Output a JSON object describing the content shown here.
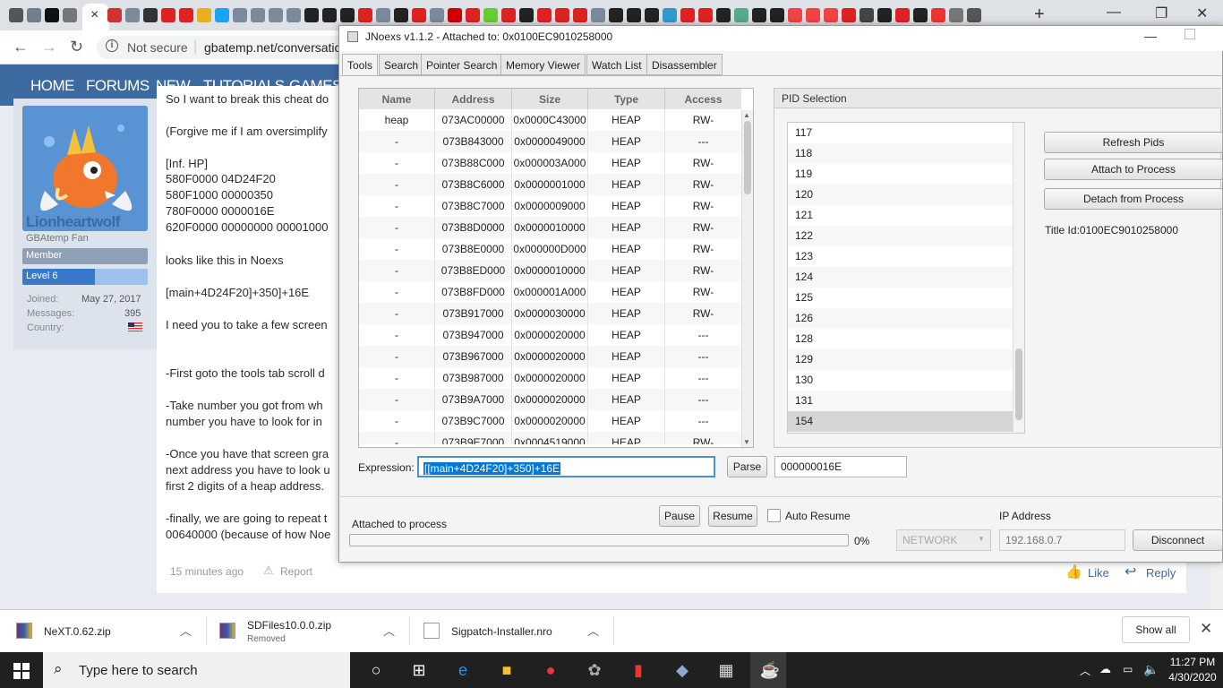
{
  "browser": {
    "tab_close_glyph": "×",
    "new_tab_glyph": "+",
    "url_security": "Not secure",
    "url_text": "gbatemp.net/conversatic",
    "window_buttons": [
      "—",
      "❐",
      "✕"
    ]
  },
  "site": {
    "nav": [
      "HOME",
      "FORUMS",
      "NEW",
      "TUTORIALS",
      "GAMES"
    ],
    "user": {
      "name": "Lionheartwolf",
      "title": "GBAtemp Fan",
      "role": "Member",
      "level": "Level 6",
      "joined_label": "Joined:",
      "joined": "May 27, 2017",
      "messages_label": "Messages:",
      "messages": "395",
      "country_label": "Country:"
    },
    "post_lines": [
      "So I want to break this cheat do",
      "(Forgive me if I am oversimplify",
      "[Inf. HP]",
      "580F0000 04D24F20",
      "580F1000 00000350",
      "780F0000 0000016E",
      "620F0000 00000000 00001000",
      "looks like this in Noexs",
      "[main+4D24F20]+350]+16E",
      "I need you to take a few screen",
      "-First goto the tools tab scroll d",
      "-Take number you got from wh",
      "number you have to look for in",
      "-Once you have that screen gra",
      "next address you have to look u",
      "first 2 digits of a heap address.",
      "-finally, we are going to repeat t",
      "00640000 (because of how Noe"
    ],
    "post_time": "15 minutes ago",
    "report": "Report",
    "like": "Like",
    "reply": "Reply"
  },
  "jnoexs": {
    "title": "JNoexs v1.1.2 - Attached to: 0x0100EC9010258000",
    "tabs": [
      "Tools",
      "Search",
      "Pointer Search",
      "Memory Viewer",
      "Watch List",
      "Disassembler"
    ],
    "columns": [
      "Name",
      "Address",
      "Size",
      "Type",
      "Access"
    ],
    "rows": [
      [
        "heap",
        "073AC00000",
        "0x0000C43000",
        "HEAP",
        "RW-"
      ],
      [
        "-",
        "073B843000",
        "0x0000049000",
        "HEAP",
        "---"
      ],
      [
        "-",
        "073B88C000",
        "0x000003A000",
        "HEAP",
        "RW-"
      ],
      [
        "-",
        "073B8C6000",
        "0x0000001000",
        "HEAP",
        "RW-"
      ],
      [
        "-",
        "073B8C7000",
        "0x0000009000",
        "HEAP",
        "RW-"
      ],
      [
        "-",
        "073B8D0000",
        "0x0000010000",
        "HEAP",
        "RW-"
      ],
      [
        "-",
        "073B8E0000",
        "0x000000D000",
        "HEAP",
        "RW-"
      ],
      [
        "-",
        "073B8ED000",
        "0x0000010000",
        "HEAP",
        "RW-"
      ],
      [
        "-",
        "073B8FD000",
        "0x000001A000",
        "HEAP",
        "RW-"
      ],
      [
        "-",
        "073B917000",
        "0x0000030000",
        "HEAP",
        "RW-"
      ],
      [
        "-",
        "073B947000",
        "0x0000020000",
        "HEAP",
        "---"
      ],
      [
        "-",
        "073B967000",
        "0x0000020000",
        "HEAP",
        "---"
      ],
      [
        "-",
        "073B987000",
        "0x0000020000",
        "HEAP",
        "---"
      ],
      [
        "-",
        "073B9A7000",
        "0x0000020000",
        "HEAP",
        "---"
      ],
      [
        "-",
        "073B9C7000",
        "0x0000020000",
        "HEAP",
        "---"
      ],
      [
        "-",
        "073B9E7000",
        "0x0004519000",
        "HEAP",
        "RW-"
      ]
    ],
    "pid_title": "PID Selection",
    "pids": [
      "117",
      "118",
      "119",
      "120",
      "121",
      "122",
      "123",
      "124",
      "125",
      "126",
      "128",
      "129",
      "130",
      "131",
      "154"
    ],
    "selected_pid": "154",
    "refresh_pids": "Refresh Pids",
    "attach": "Attach to Process",
    "detach": "Detach from Process",
    "title_id": "Title Id:0100EC9010258000",
    "expression_label": "Expression:",
    "expression_value": "[[main+4D24F20]+350]+16E",
    "parse": "Parse",
    "parse_result": "000000016E",
    "pause": "Pause",
    "resume": "Resume",
    "auto_resume": "Auto Resume",
    "status": "Attached to process",
    "progress_percent": 0,
    "progress_text": "0%",
    "network": "NETWORK",
    "ip_label": "IP Address",
    "ip_placeholder": "192.168.0.7",
    "disconnect": "Disconnect"
  },
  "downloads": {
    "items": [
      {
        "name": "NeXT.0.62.zip",
        "sub": ""
      },
      {
        "name": "SDFiles10.0.0.zip",
        "sub": "Removed"
      },
      {
        "name": "Sigpatch-Installer.nro",
        "sub": ""
      }
    ],
    "show_all": "Show all"
  },
  "taskbar": {
    "search_placeholder": "Type here to search",
    "time": "11:27 PM",
    "date": "4/30/2020"
  },
  "colors": {
    "accent_blue": "#3e6aa2",
    "selection": "#0078d7",
    "taskbar": "#202020"
  }
}
